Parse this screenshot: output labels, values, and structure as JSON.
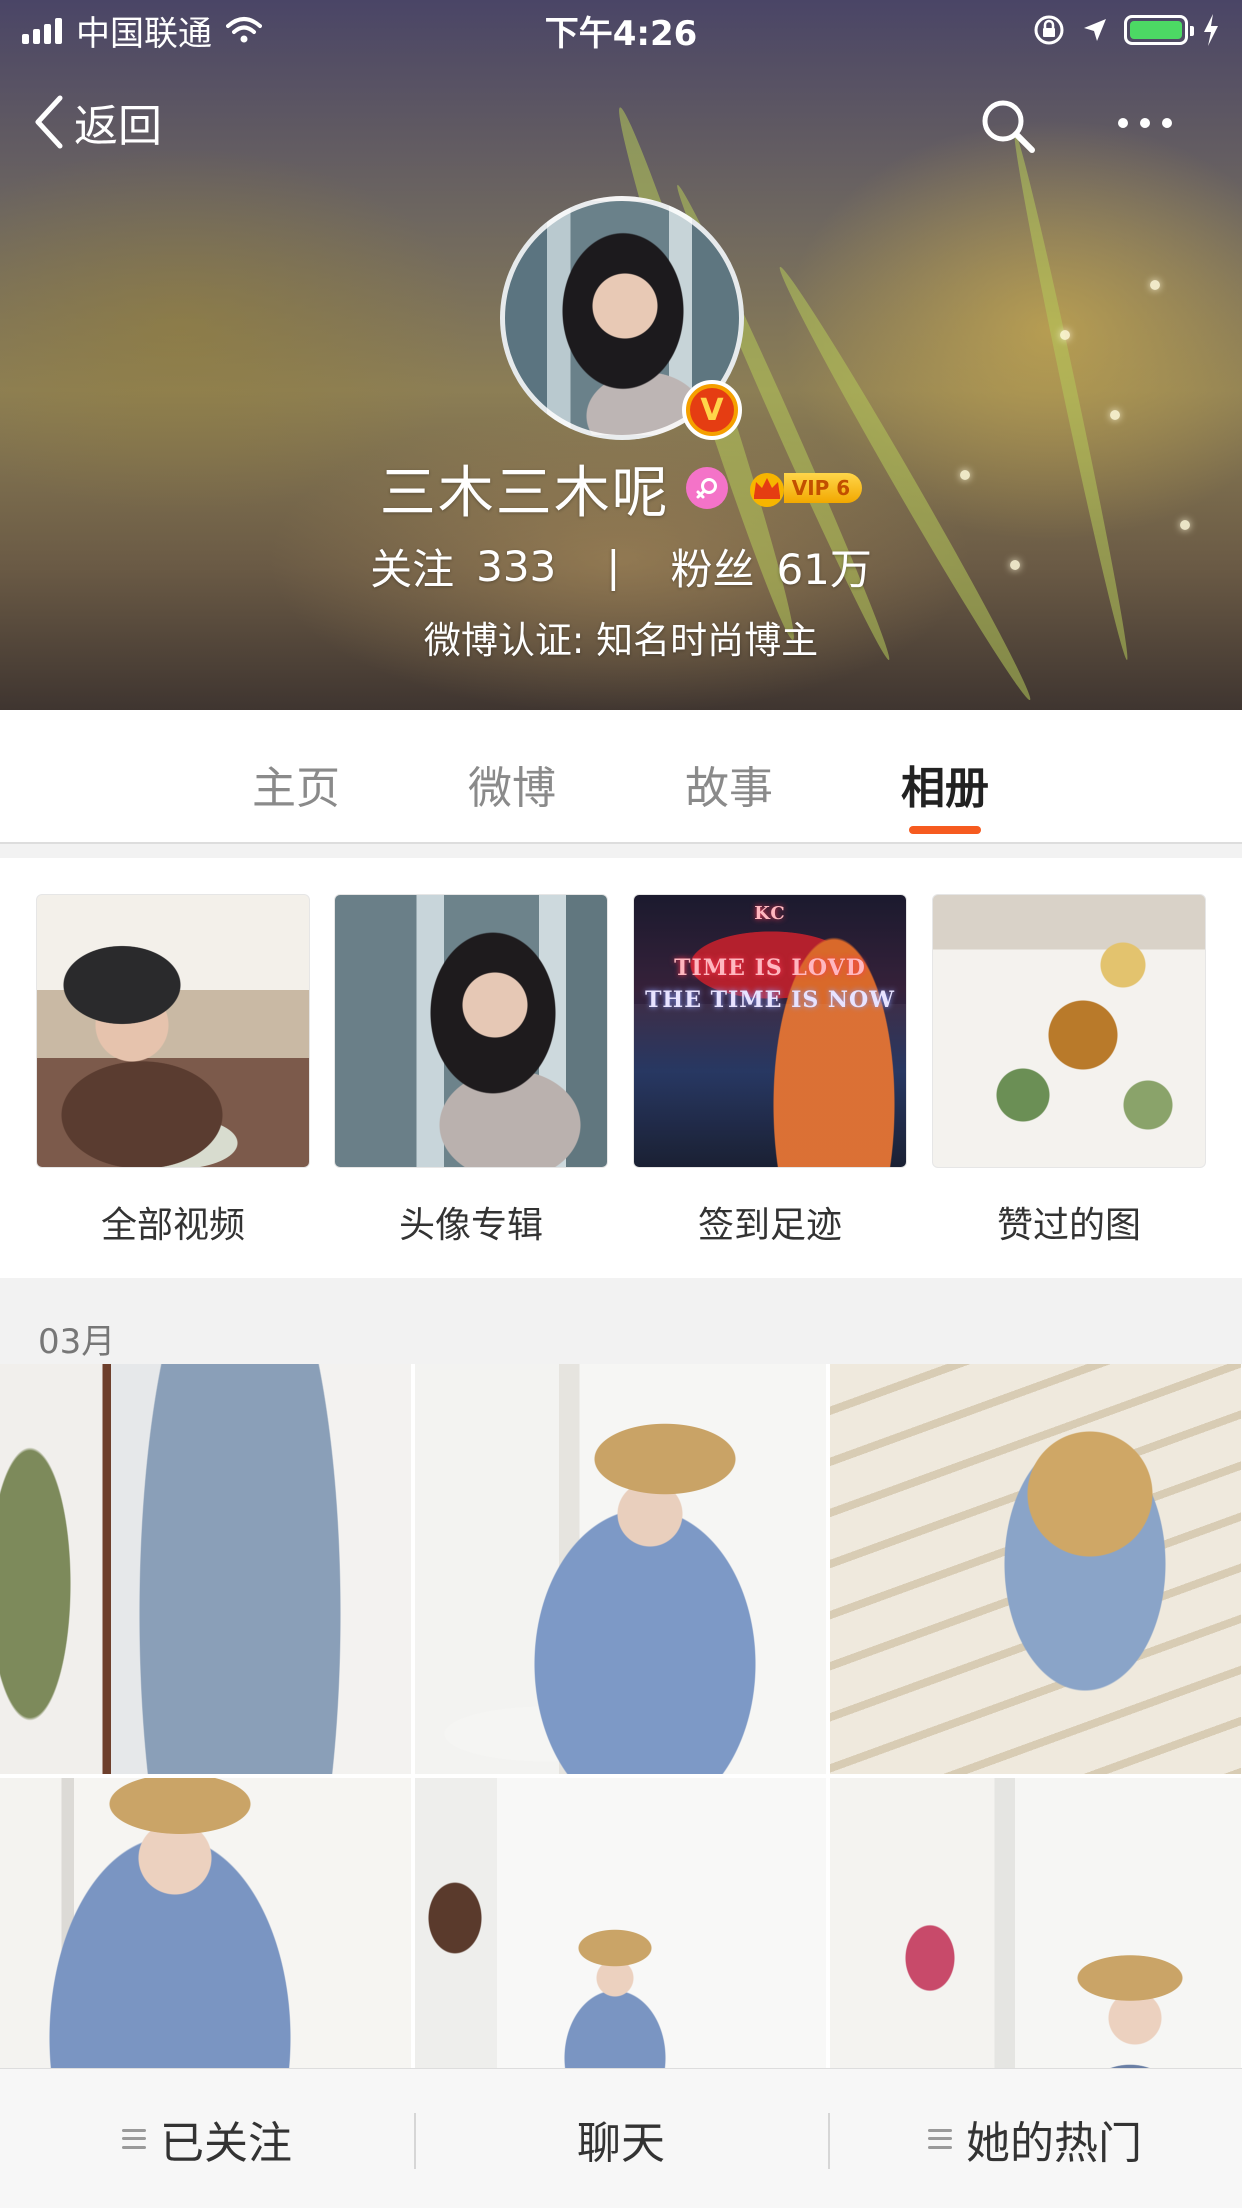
{
  "status_bar": {
    "carrier": "中国联通",
    "time": "下午4:26",
    "battery_color": "#4cd964"
  },
  "nav": {
    "back_label": "返回",
    "icons": [
      "chevron-left-icon",
      "search-icon",
      "more-icon"
    ]
  },
  "profile": {
    "name": "三木三木呢",
    "verified_badge": "V",
    "vip_label": "VIP 6",
    "stats": {
      "following_label": "关注",
      "following_value": "333",
      "separator": "|",
      "fans_label": "粉丝",
      "fans_value": "61万"
    },
    "verification": "微博认证: 知名时尚博主"
  },
  "tabs": [
    {
      "label": "主页",
      "active": false
    },
    {
      "label": "微博",
      "active": false
    },
    {
      "label": "故事",
      "active": false
    },
    {
      "label": "相册",
      "active": true
    }
  ],
  "accent_color": "#f65b1f",
  "albums": [
    {
      "label": "全部视频"
    },
    {
      "label": "头像专辑"
    },
    {
      "label": "签到足迹",
      "thumb_text": [
        "KC",
        "TIME IS LOVD",
        "THE TIME IS NOW"
      ]
    },
    {
      "label": "赞过的图"
    }
  ],
  "month": "03月",
  "bottom_bar": {
    "followed_label": "已关注",
    "chat_label": "聊天",
    "hot_label": "她的热门"
  }
}
